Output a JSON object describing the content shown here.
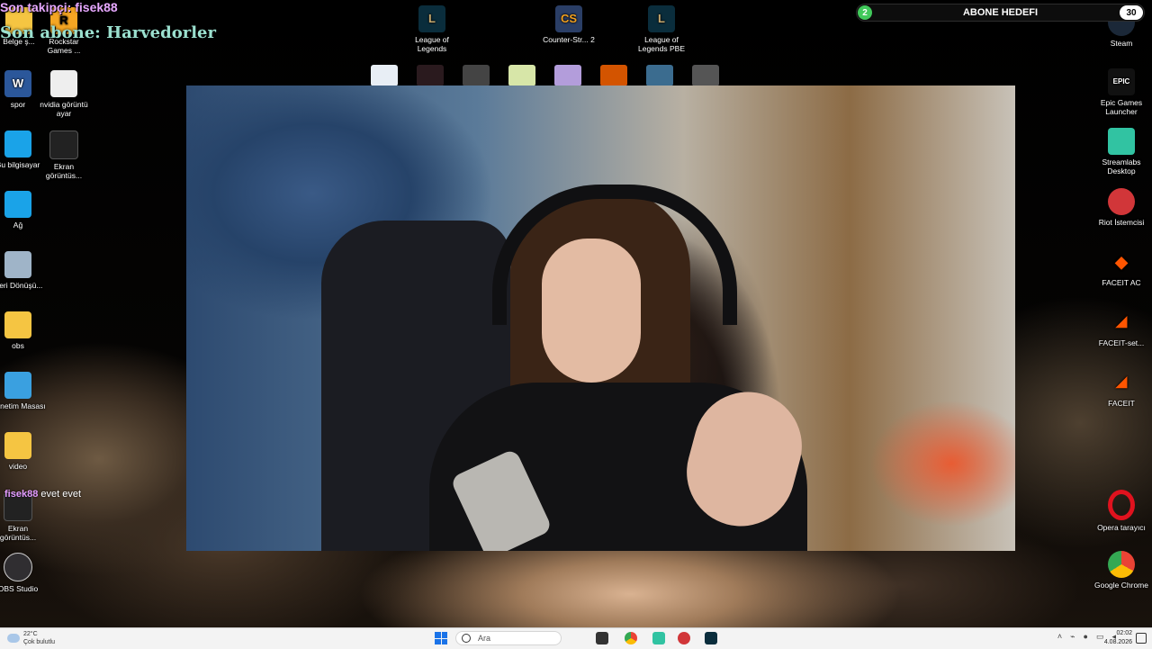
{
  "overlay": {
    "last_follower": "Son takipçi: fisek88",
    "last_subscriber": "Son abone: Harvedorler",
    "chat": {
      "user": "fisek88",
      "message": "evet evet"
    }
  },
  "goal": {
    "label": "ABONE HEDEFI",
    "current": "2",
    "target": "30",
    "progress": 0.067
  },
  "desktop_left": [
    {
      "label": "Belge ş...",
      "icon": "folder-icon",
      "color": "#f5c542"
    },
    {
      "label": "Rockstar Games ...",
      "icon": "rockstar-icon",
      "color": "#f5a623"
    },
    {
      "label": "spor",
      "icon": "word-icon",
      "color": "#2b579a"
    },
    {
      "label": "nvidia görüntü ayar",
      "icon": "document-icon",
      "color": "#eeeeee"
    },
    {
      "label": "Bu bilgisayar",
      "icon": "monitor-icon",
      "color": "#1aa3e8"
    },
    {
      "label": "Ekran görüntüs...",
      "icon": "screenshot-icon",
      "color": "#222222"
    },
    {
      "label": "Ağ",
      "icon": "network-icon",
      "color": "#1aa3e8"
    },
    {
      "label": "Geri Dönüşü...",
      "icon": "recycle-bin-icon",
      "color": "#9fb4c8"
    },
    {
      "label": "obs",
      "icon": "folder-icon",
      "color": "#f5c542"
    },
    {
      "label": "Denetim Masası",
      "icon": "control-panel-icon",
      "color": "#3aa0e0"
    },
    {
      "label": "video",
      "icon": "folder-icon",
      "color": "#f5c542"
    },
    {
      "label": "Ekran görüntüs...",
      "icon": "screenshot-icon",
      "color": "#222222"
    },
    {
      "label": "OBS Studio",
      "icon": "obs-icon",
      "color": "#302e31"
    }
  ],
  "desktop_top": [
    {
      "label": "League of Legends",
      "icon": "league-icon",
      "color": "#0a2d3c"
    },
    {
      "label": "Counter-Str... 2",
      "icon": "counter-strike-icon",
      "color": "#2a3e66"
    },
    {
      "label": "League of Legends PBE",
      "icon": "league-pbe-icon",
      "color": "#0a2d3c"
    }
  ],
  "desktop_right": [
    {
      "label": "Steam",
      "icon": "steam-icon",
      "color": "#1b2838"
    },
    {
      "label": "Epic Games Launcher",
      "icon": "epic-games-icon",
      "color": "#111111"
    },
    {
      "label": "Streamlabs Desktop",
      "icon": "streamlabs-icon",
      "color": "#31c3a2"
    },
    {
      "label": "Riot İstemcisi",
      "icon": "riot-icon",
      "color": "#d13639"
    },
    {
      "label": "FACEIT AC",
      "icon": "faceit-ac-icon",
      "color": "#ff5500"
    },
    {
      "label": "FACEIT-set...",
      "icon": "faceit-setup-icon",
      "color": "#ff5500"
    },
    {
      "label": "FACEIT",
      "icon": "faceit-icon",
      "color": "#ff5500"
    },
    {
      "label": "Opera tarayıcı",
      "icon": "opera-icon",
      "color": "#e0121e"
    },
    {
      "label": "Google Chrome",
      "icon": "chrome-icon",
      "color": "#4285f4"
    }
  ],
  "taskbar": {
    "weather_temp": "22°C",
    "weather_desc": "Çok bulutlu",
    "search_placeholder": "Ara",
    "time": "02:02",
    "date": "4.08.2026"
  }
}
